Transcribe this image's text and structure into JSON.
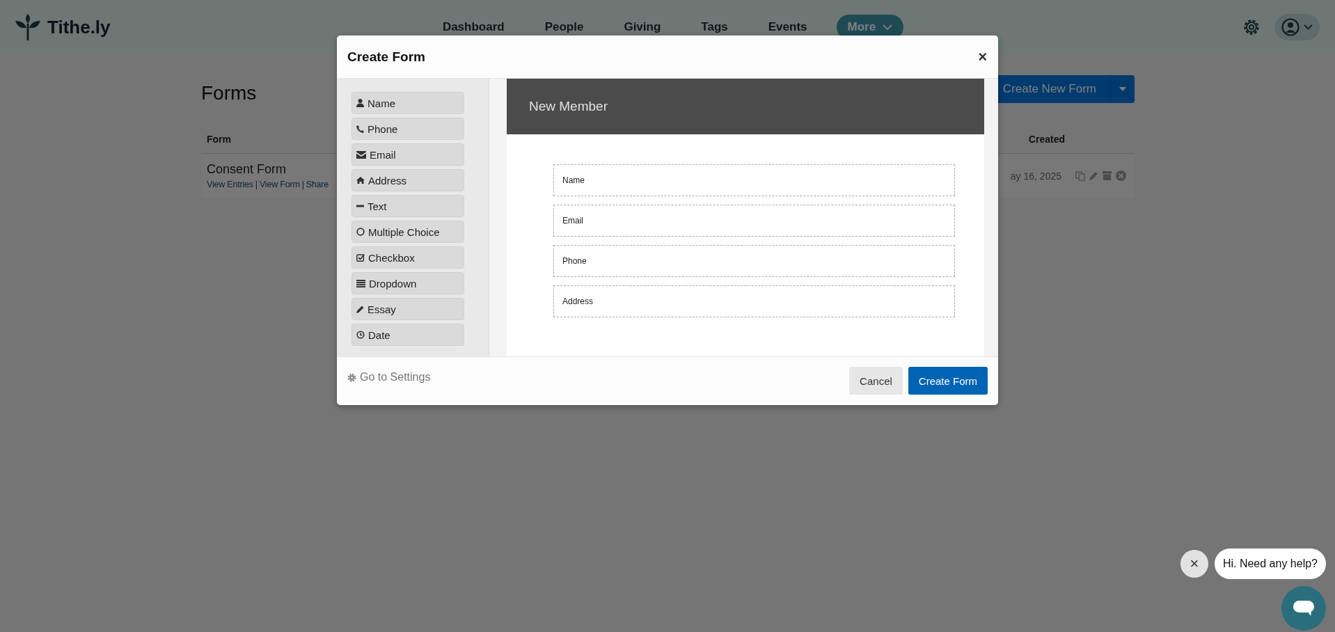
{
  "header": {
    "logo": "Tithe.ly",
    "nav": [
      {
        "label": "Dashboard",
        "selected": false
      },
      {
        "label": "People",
        "selected": false
      },
      {
        "label": "Giving",
        "selected": false
      },
      {
        "label": "Tags",
        "selected": false
      },
      {
        "label": "Events",
        "selected": false
      },
      {
        "label": "More",
        "selected": true
      }
    ]
  },
  "page": {
    "title": "Forms",
    "create_button": "Create New Form",
    "table": {
      "columns": [
        "Form",
        "Created"
      ],
      "rows": [
        {
          "name": "Consent Form",
          "links": [
            "View Entries",
            "View Form",
            "Share"
          ],
          "separator": "|",
          "created": "ay 16, 2025"
        }
      ]
    }
  },
  "modal": {
    "title": "Create Form",
    "close": "×",
    "field_types": [
      {
        "label": "Name",
        "kind": "person"
      },
      {
        "label": "Phone",
        "kind": "phone"
      },
      {
        "label": "Email",
        "kind": "mail"
      },
      {
        "label": "Address",
        "kind": "home"
      },
      {
        "label": "Text",
        "kind": "line"
      },
      {
        "label": "Multiple Choice",
        "kind": "circle"
      },
      {
        "label": "Checkbox",
        "kind": "check"
      },
      {
        "label": "Dropdown",
        "kind": "lines"
      },
      {
        "label": "Essay",
        "kind": "pencil"
      },
      {
        "label": "Date",
        "kind": "clock"
      }
    ],
    "preview": {
      "title": "New Member",
      "fields": [
        "Name",
        "Email",
        "Phone",
        "Address"
      ]
    },
    "settings_link": "Go to Settings",
    "buttons": [
      {
        "label": "Cancel",
        "kind": "secondary"
      },
      {
        "label": "Create Form",
        "kind": "primary"
      }
    ]
  },
  "chat": {
    "close": "×",
    "message": "Hi. Need any help?"
  }
}
